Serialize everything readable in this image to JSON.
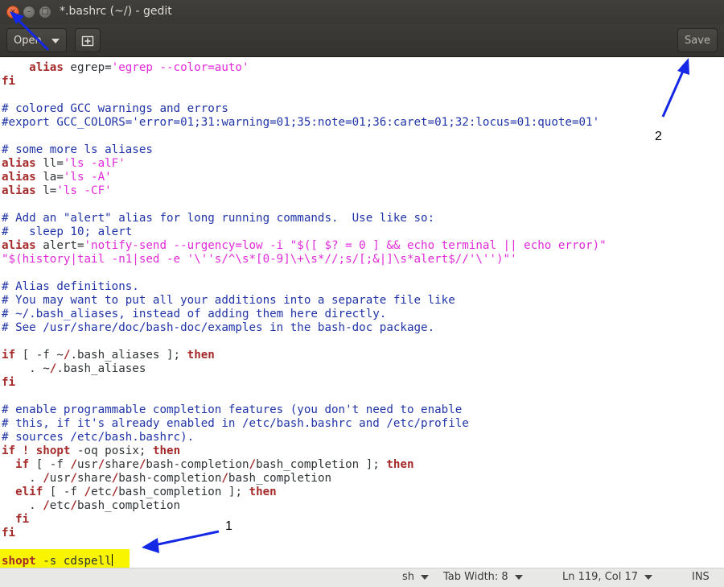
{
  "window": {
    "title": "*.bashrc (~/) - gedit",
    "controls": {
      "close": "×",
      "minimize": "–",
      "maximize": "□"
    }
  },
  "header": {
    "open_label": "Open",
    "newtab_icon": "new-tab-icon",
    "save_label": "Save"
  },
  "editor": {
    "lines": [
      [
        [
          "    ",
          "plain"
        ],
        [
          "alias",
          "kw"
        ],
        [
          " egrep=",
          "plain"
        ],
        [
          "'egrep --color=auto'",
          "str"
        ]
      ],
      [
        [
          "fi",
          "kw"
        ]
      ],
      [],
      [
        [
          "# colored GCC warnings and errors",
          "com"
        ]
      ],
      [
        [
          "#export GCC_COLORS='error=01;31:warning=01;35:note=01;36:caret=01;32:locus=01:quote=01'",
          "com"
        ]
      ],
      [],
      [
        [
          "# some more ls aliases",
          "com"
        ]
      ],
      [
        [
          "alias",
          "kw"
        ],
        [
          " ll=",
          "plain"
        ],
        [
          "'ls -alF'",
          "str"
        ]
      ],
      [
        [
          "alias",
          "kw"
        ],
        [
          " la=",
          "plain"
        ],
        [
          "'ls -A'",
          "str"
        ]
      ],
      [
        [
          "alias",
          "kw"
        ],
        [
          " l=",
          "plain"
        ],
        [
          "'ls -CF'",
          "str"
        ]
      ],
      [],
      [
        [
          "# Add an \"alert\" alias for long running commands.  Use like so:",
          "com"
        ]
      ],
      [
        [
          "#   sleep 10; alert",
          "com"
        ]
      ],
      [
        [
          "alias",
          "kw"
        ],
        [
          " alert=",
          "plain"
        ],
        [
          "'notify-send --urgency=low -i \"$([ $? = 0 ] && echo terminal || echo error)\"",
          "str"
        ]
      ],
      [
        [
          "\"$(history|tail -n1|sed -e '\\''s/^\\s*[0-9]\\+\\s*//;s/[;&|]\\s*alert$//'\\'')\"'",
          "str"
        ]
      ],
      [],
      [
        [
          "# Alias definitions.",
          "com"
        ]
      ],
      [
        [
          "# You may want to put all your additions into a separate file like",
          "com"
        ]
      ],
      [
        [
          "# ~/.bash_aliases, instead of adding them here directly.",
          "com"
        ]
      ],
      [
        [
          "# See /usr/share/doc/bash-doc/examples in the bash-doc package.",
          "com"
        ]
      ],
      [],
      [
        [
          "if",
          "kw"
        ],
        [
          " [ -f ~",
          "plain"
        ],
        [
          "/",
          "path"
        ],
        [
          ".bash_aliases ]; ",
          "plain"
        ],
        [
          "then",
          "kw"
        ]
      ],
      [
        [
          "    . ~",
          "plain"
        ],
        [
          "/",
          "path"
        ],
        [
          ".bash_aliases",
          "plain"
        ]
      ],
      [
        [
          "fi",
          "kw"
        ]
      ],
      [],
      [
        [
          "# enable programmable completion features (you don't need to enable",
          "com"
        ]
      ],
      [
        [
          "# this, if it's already enabled in /etc/bash.bashrc and /etc/profile",
          "com"
        ]
      ],
      [
        [
          "# sources /etc/bash.bashrc).",
          "com"
        ]
      ],
      [
        [
          "if",
          "kw"
        ],
        [
          " ",
          "plain"
        ],
        [
          "!",
          "kw"
        ],
        [
          " ",
          "plain"
        ],
        [
          "shopt",
          "kw"
        ],
        [
          " -oq posix; ",
          "plain"
        ],
        [
          "then",
          "kw"
        ]
      ],
      [
        [
          "  ",
          "plain"
        ],
        [
          "if",
          "kw"
        ],
        [
          " [ -f ",
          "plain"
        ],
        [
          "/",
          "path"
        ],
        [
          "usr",
          "plain"
        ],
        [
          "/",
          "path"
        ],
        [
          "share",
          "plain"
        ],
        [
          "/",
          "path"
        ],
        [
          "bash-completion",
          "plain"
        ],
        [
          "/",
          "path"
        ],
        [
          "bash_completion ]; ",
          "plain"
        ],
        [
          "then",
          "kw"
        ]
      ],
      [
        [
          "    . ",
          "plain"
        ],
        [
          "/",
          "path"
        ],
        [
          "usr",
          "plain"
        ],
        [
          "/",
          "path"
        ],
        [
          "share",
          "plain"
        ],
        [
          "/",
          "path"
        ],
        [
          "bash-completion",
          "plain"
        ],
        [
          "/",
          "path"
        ],
        [
          "bash_completion",
          "plain"
        ]
      ],
      [
        [
          "  ",
          "plain"
        ],
        [
          "elif",
          "kw"
        ],
        [
          " [ -f ",
          "plain"
        ],
        [
          "/",
          "path"
        ],
        [
          "etc",
          "plain"
        ],
        [
          "/",
          "path"
        ],
        [
          "bash_completion ]; ",
          "plain"
        ],
        [
          "then",
          "kw"
        ]
      ],
      [
        [
          "    . ",
          "plain"
        ],
        [
          "/",
          "path"
        ],
        [
          "etc",
          "plain"
        ],
        [
          "/",
          "path"
        ],
        [
          "bash_completion",
          "plain"
        ]
      ],
      [
        [
          "  ",
          "plain"
        ],
        [
          "fi",
          "kw"
        ]
      ],
      [
        [
          "fi",
          "kw"
        ]
      ],
      [],
      [
        [
          "shopt",
          "kw"
        ],
        [
          " -s cdspell",
          "plain"
        ]
      ]
    ]
  },
  "status": {
    "language": "sh",
    "tab_width": "Tab Width: 8",
    "position": "Ln 119, Col 17",
    "mode": "INS"
  },
  "annotations": {
    "label_1": "1",
    "label_2": "2",
    "arrow_color": "#1428e6"
  },
  "colors": {
    "keyword": "#a52a2a",
    "string": "#e12ad9",
    "comment": "#2034a8",
    "highlight": "#f9f400"
  }
}
